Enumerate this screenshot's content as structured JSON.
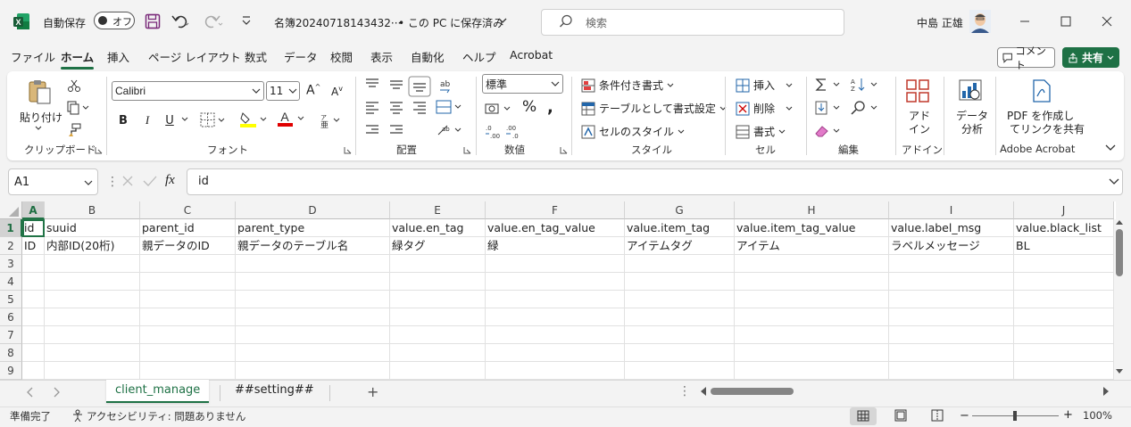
{
  "titlebar": {
    "autosave_label": "自動保存",
    "autosave_state": "オフ",
    "filename": "名簿20240718143432···",
    "save_status": "• この PC に保存済み",
    "search_placeholder": "検索",
    "user_name": "中島 正雄"
  },
  "menu": {
    "tabs": [
      "ファイル",
      "ホーム",
      "挿入",
      "ページ レイアウト",
      "数式",
      "データ",
      "校閲",
      "表示",
      "自動化",
      "ヘルプ",
      "Acrobat"
    ],
    "active_index": 1,
    "comment_button": "コメント",
    "share_button": "共有"
  },
  "ribbon": {
    "clipboard": {
      "paste": "貼り付け",
      "label": "クリップボード"
    },
    "font": {
      "name": "Calibri",
      "size": "11",
      "label": "フォント",
      "bold": "B",
      "italic": "I",
      "underline": "U"
    },
    "alignment": {
      "label": "配置"
    },
    "number": {
      "format": "標準",
      "label": "数値",
      "percent": "%"
    },
    "styles": {
      "conditional": "条件付き書式",
      "table": "テーブルとして書式設定",
      "cell": "セルのスタイル",
      "label": "スタイル"
    },
    "cells": {
      "insert": "挿入",
      "delete": "削除",
      "format": "書式",
      "label": "セル"
    },
    "editing": {
      "label": "編集"
    },
    "addin": {
      "line1": "アド",
      "line2": "イン",
      "label": "アドイン"
    },
    "analysis": {
      "line1": "データ",
      "line2": "分析"
    },
    "acrobat": {
      "line1": "PDF を作成し",
      "line2": "てリンクを共有",
      "label": "Adobe Acrobat"
    }
  },
  "formula_bar": {
    "cell_ref": "A1",
    "content": "id",
    "fx": "fx"
  },
  "grid": {
    "columns": [
      "A",
      "B",
      "C",
      "D",
      "E",
      "F",
      "G",
      "H",
      "I",
      "J"
    ],
    "rows": [
      "1",
      "2",
      "3",
      "4",
      "5",
      "6",
      "7",
      "8",
      "9"
    ],
    "data": [
      [
        "id",
        "suuid",
        "parent_id",
        "parent_type",
        "value.en_tag",
        "value.en_tag_value",
        "value.item_tag",
        "value.item_tag_value",
        "value.label_msg",
        "value.black_list"
      ],
      [
        "ID",
        "内部ID(20桁)",
        "親データのID",
        "親データのテーブル名",
        "緑タグ",
        "緑",
        "アイテムタグ",
        "アイテム",
        "ラベルメッセージ",
        "BL"
      ]
    ]
  },
  "sheets": {
    "tabs": [
      "client_manage",
      "##setting##"
    ],
    "active_index": 0
  },
  "status": {
    "ready": "準備完了",
    "accessibility": "アクセシビリティ: 問題ありません",
    "zoom": "100%"
  },
  "colors": {
    "accent": "#217346",
    "share": "#1e7145"
  }
}
